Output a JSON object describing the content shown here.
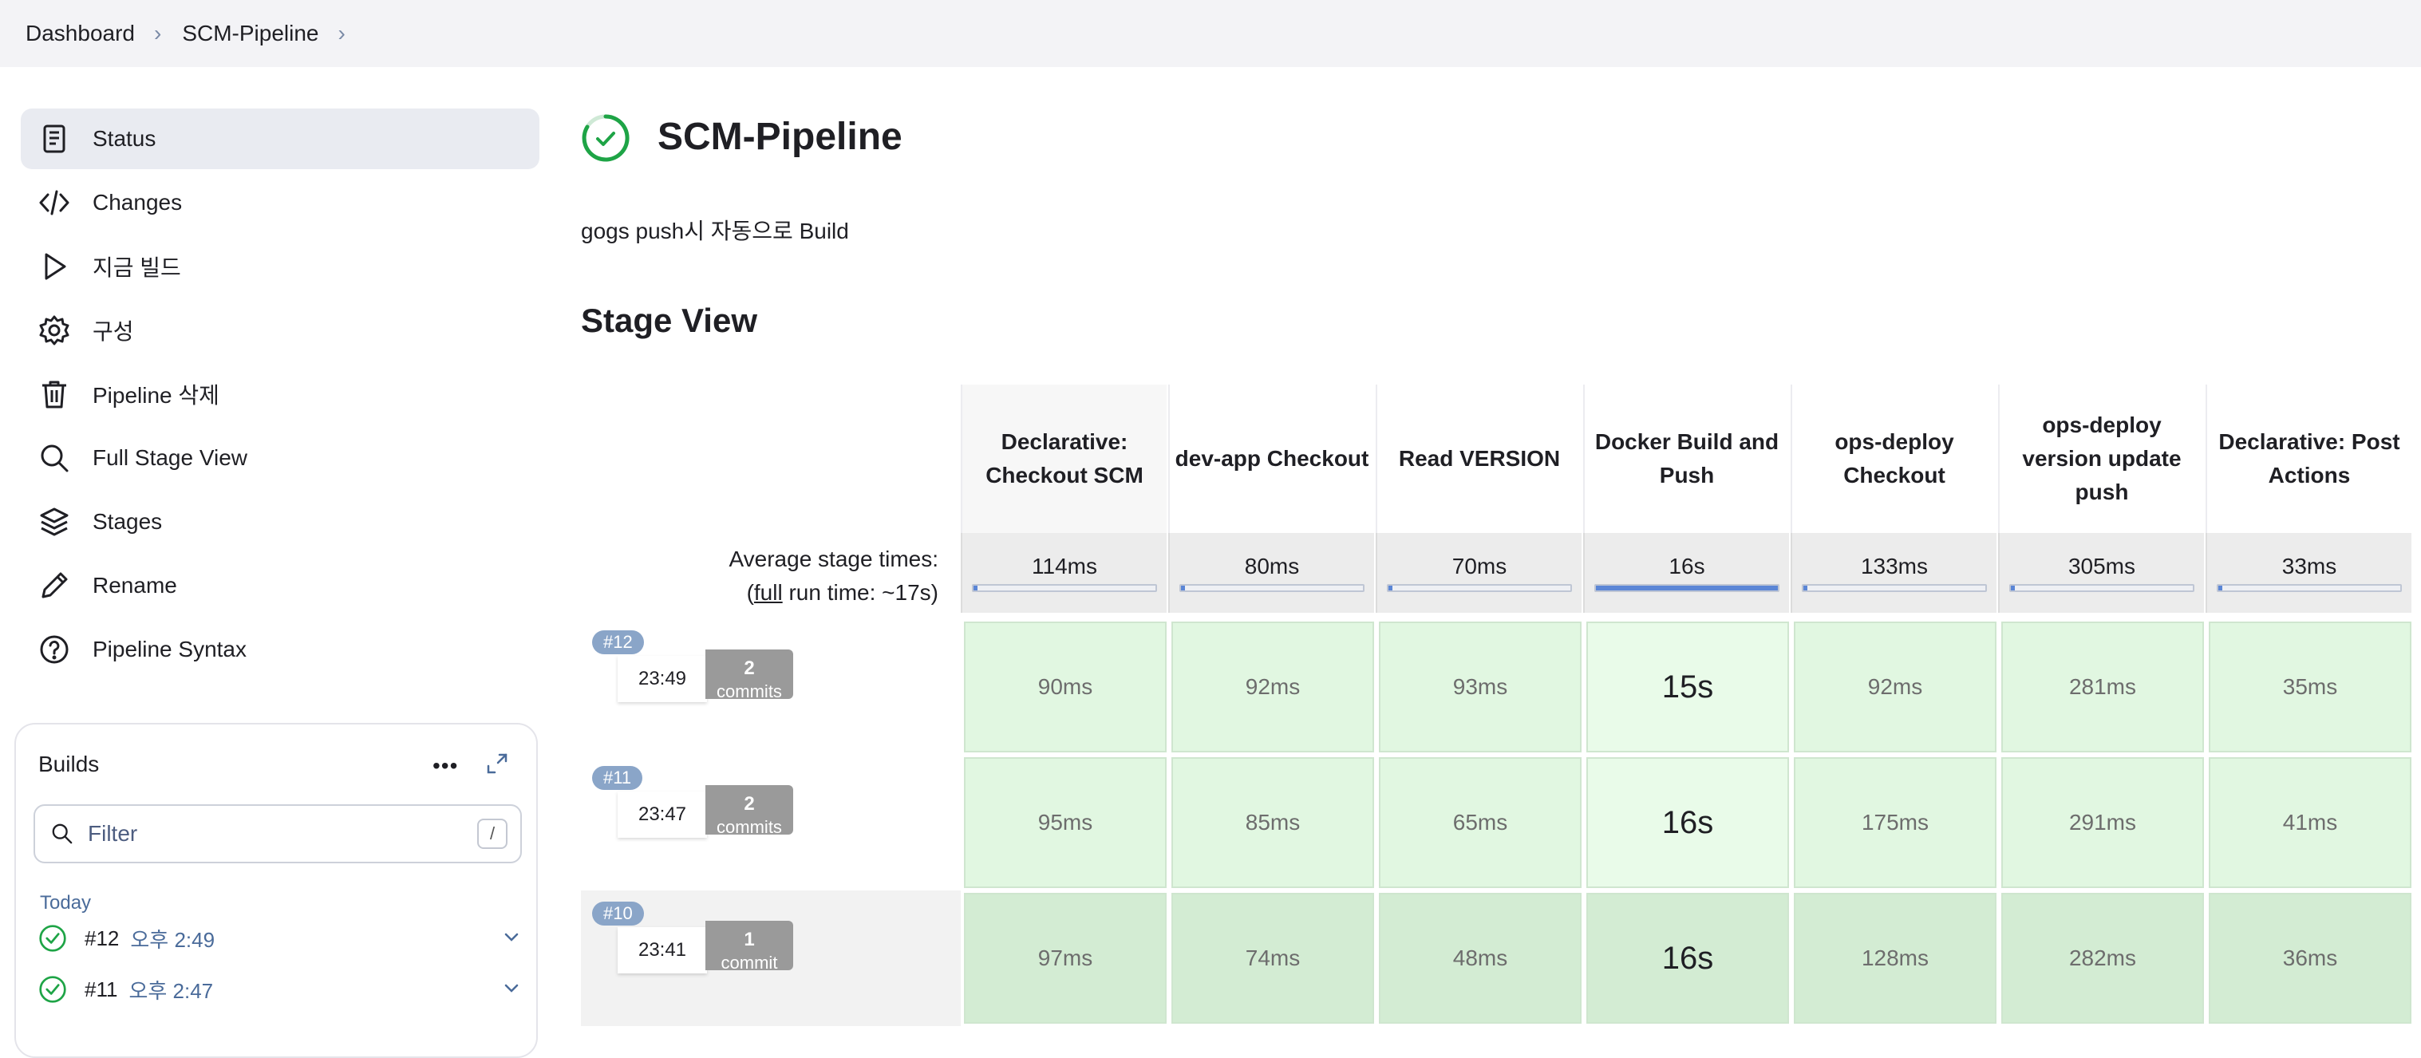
{
  "breadcrumb": [
    "Dashboard",
    "SCM-Pipeline"
  ],
  "sidebar": {
    "items": [
      {
        "label": "Status",
        "icon": "document-icon",
        "active": true
      },
      {
        "label": "Changes",
        "icon": "code-icon"
      },
      {
        "label": "지금 빌드",
        "icon": "play-icon"
      },
      {
        "label": "구성",
        "icon": "gear-icon"
      },
      {
        "label": "Pipeline 삭제",
        "icon": "trash-icon"
      },
      {
        "label": "Full Stage View",
        "icon": "search-icon"
      },
      {
        "label": "Stages",
        "icon": "layers-icon"
      },
      {
        "label": "Rename",
        "icon": "pencil-icon"
      },
      {
        "label": "Pipeline Syntax",
        "icon": "help-icon"
      }
    ]
  },
  "builds": {
    "title": "Builds",
    "more": "•••",
    "filter_placeholder": "Filter",
    "filter_shortcut": "/",
    "group": "Today",
    "list": [
      {
        "number": "#12",
        "time": "오후 2:49"
      },
      {
        "number": "#11",
        "time": "오후 2:47"
      }
    ]
  },
  "main": {
    "title": "SCM-Pipeline",
    "description": "gogs push시 자동으로 Build",
    "stage_view_title": "Stage View",
    "avg_label": "Average stage times:",
    "full_run_prefix": "(",
    "full_link": "full",
    "full_run_suffix": " run time: ~17s)"
  },
  "stages": [
    {
      "name": "Declarative: Checkout SCM",
      "avg": "114ms",
      "avg_ms": 114
    },
    {
      "name": "dev-app Checkout",
      "avg": "80ms",
      "avg_ms": 80
    },
    {
      "name": "Read VERSION",
      "avg": "70ms",
      "avg_ms": 70
    },
    {
      "name": "Docker Build and Push",
      "avg": "16s",
      "avg_ms": 16000
    },
    {
      "name": "ops-deploy Checkout",
      "avg": "133ms",
      "avg_ms": 133
    },
    {
      "name": "ops-deploy version update push",
      "avg": "305ms",
      "avg_ms": 305
    },
    {
      "name": "Declarative: Post Actions",
      "avg": "33ms",
      "avg_ms": 33
    }
  ],
  "runs": [
    {
      "id": "#12",
      "time": "23:49",
      "commits": "2",
      "commits_label": "commits",
      "cells": [
        "90ms",
        "92ms",
        "93ms",
        "15s",
        "92ms",
        "281ms",
        "35ms"
      ]
    },
    {
      "id": "#11",
      "time": "23:47",
      "commits": "2",
      "commits_label": "commits",
      "cells": [
        "95ms",
        "85ms",
        "65ms",
        "16s",
        "175ms",
        "291ms",
        "41ms"
      ]
    },
    {
      "id": "#10",
      "time": "23:41",
      "commits": "1",
      "commits_label": "commit",
      "cells": [
        "97ms",
        "74ms",
        "48ms",
        "16s",
        "128ms",
        "282ms",
        "36ms"
      ]
    }
  ],
  "colors": {
    "success": "#1ea446",
    "cell_green": "#e1f7e1",
    "progress": "#5b86d6"
  }
}
